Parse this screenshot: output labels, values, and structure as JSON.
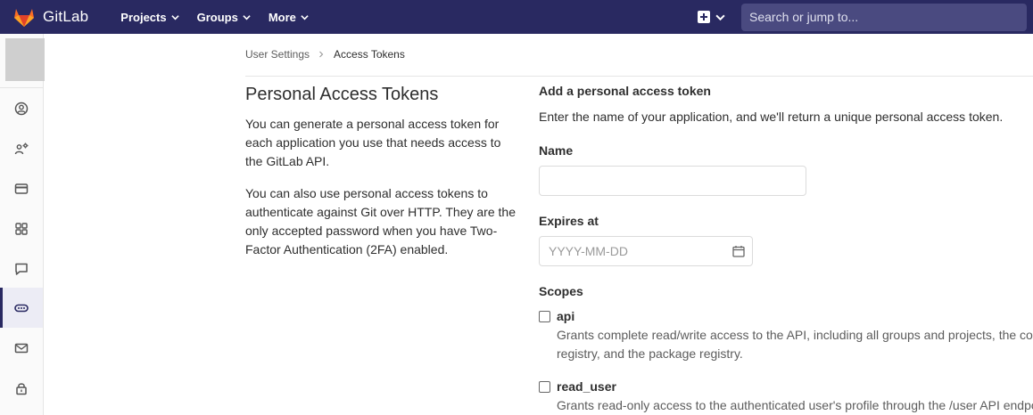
{
  "navbar": {
    "brand": "GitLab",
    "links": [
      {
        "label": "Projects",
        "icon": "chevron-down-icon"
      },
      {
        "label": "Groups",
        "icon": "chevron-down-icon"
      },
      {
        "label": "More",
        "icon": "chevron-down-icon"
      }
    ],
    "search_placeholder": "Search or jump to...",
    "colors": {
      "navbar": "#292961",
      "search": "#4a4a80"
    }
  },
  "sidebar": {
    "items": [
      {
        "icon": "profile-icon"
      },
      {
        "icon": "account-icon"
      },
      {
        "icon": "credit-card-icon"
      },
      {
        "icon": "applications-icon"
      },
      {
        "icon": "comment-icon"
      },
      {
        "icon": "access-tokens-icon",
        "active": true
      },
      {
        "icon": "mail-icon"
      },
      {
        "icon": "lock-icon"
      }
    ]
  },
  "breadcrumb": {
    "parent": "User Settings",
    "current": "Access Tokens"
  },
  "left": {
    "title": "Personal Access Tokens",
    "para1": "You can generate a personal access token for each application you use that needs access to the GitLab API.",
    "para2": "You can also use personal access tokens to authenticate against Git over HTTP. They are the only accepted password when you have Two-Factor Authentication (2FA) enabled."
  },
  "form": {
    "title": "Add a personal access token",
    "description": "Enter the name of your application, and we'll return a unique personal access token.",
    "name_label": "Name",
    "name_value": "",
    "expires_label": "Expires at",
    "expires_placeholder": "YYYY-MM-DD",
    "scopes_label": "Scopes",
    "scopes": [
      {
        "name": "api",
        "checked": false,
        "desc_line1": "Grants complete read/write access to the API, including all groups and projects, the container",
        "desc_line2": "registry, and the package registry."
      },
      {
        "name": "read_user",
        "checked": false,
        "desc_line1": "Grants read-only access to the authenticated user's profile through the /user API endpoint"
      }
    ]
  }
}
